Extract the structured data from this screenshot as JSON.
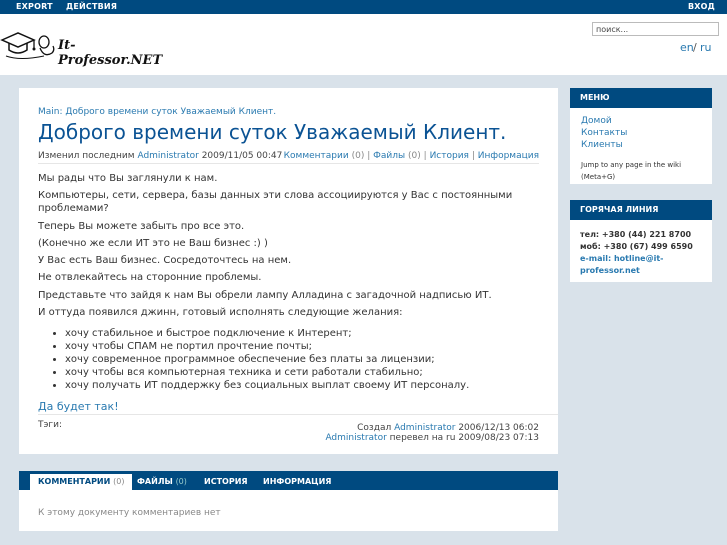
{
  "topbar": {
    "export": "EXPORT",
    "actions": "ДЕЙСТВИЯ",
    "login": "ВХОД"
  },
  "header": {
    "logo_text": "It-Professor.NET",
    "search_placeholder": "поиск...",
    "lang_en": "en",
    "lang_sep": "/",
    "lang_ru": "ru"
  },
  "page": {
    "breadcrumb": "Main: Доброго времени суток Уважаемый Клиент.",
    "title": "Доброго времени суток Уважаемый Клиент.",
    "meta": {
      "prefix": "Изменил последним",
      "author": "Administrator",
      "date": "2009/11/05 00:47"
    },
    "tabs": {
      "comments": "Комментарии",
      "comments_count": "(0)",
      "files": "Файлы",
      "files_count": "(0)",
      "history": "История",
      "info": "Информация",
      "sep": "|"
    },
    "paragraphs": [
      "Мы рады что Вы заглянули к нам.",
      "Компьютеры, сети, сервера, базы данных эти слова ассоциируются у Вас с постоянными проблемами?",
      "Теперь Вы можете забыть про все это.",
      "(Конечно же если ИТ это не Ваш бизнес :) )",
      "У Вас есть Ваш бизнес. Сосредоточтесь на нем.",
      "Не отвлекайтесь на сторонние проблемы.",
      "Представьте что зайдя к нам Вы обрели лампу Алладина с загадочной надписью ИТ.",
      "И оттуда появился джинн, готовый исполнять следующие желания:"
    ],
    "wishes": [
      "хочу стабильное и быстрое подключение к Интерент;",
      "хочу чтобы СПАМ не портил прочтение почты;",
      "хочу современное программное обеспечение без платы за лицензии;",
      "хочу чтобы вся компьютерная техника и сети работали стабильно;",
      "хочу получать ИТ поддержку без социальных выплат своему ИТ персоналу."
    ],
    "final": "Да будет так!",
    "tags_label": "Тэги:",
    "created_prefix": "Создал",
    "created_author": "Administrator",
    "created_date": "2006/12/13 06:02",
    "translated_author": "Administrator",
    "translated_text": "перевел на ru 2009/08/23 07:13"
  },
  "bottom": {
    "tabs": [
      {
        "label": "КОММЕНТАРИИ",
        "count": "(0)"
      },
      {
        "label": "ФАЙЛЫ",
        "count": "(0)"
      },
      {
        "label": "ИСТОРИЯ",
        "count": ""
      },
      {
        "label": "ИНФОРМАЦИЯ",
        "count": ""
      }
    ],
    "no_comments": "К этому документу комментариев нет"
  },
  "sidebar": {
    "menu_title": "МЕНЮ",
    "menu_items": [
      "Домой",
      "Контакты",
      "Клиенты"
    ],
    "jump_text": "Jump to any page in the wiki",
    "jump_shortcut": "(Meta+G)",
    "hotline_title": "ГОРЯЧАЯ ЛИНИЯ",
    "phone1": "тел: +380 (44) 221 8700",
    "phone2": "моб: +380 (67) 499 6590",
    "email": "e-mail: hotline@it-professor.net"
  },
  "colors": {
    "accent": "#004a80",
    "link": "#2a7ab0",
    "title": "#0b5394",
    "background": "#d9e2ea"
  }
}
